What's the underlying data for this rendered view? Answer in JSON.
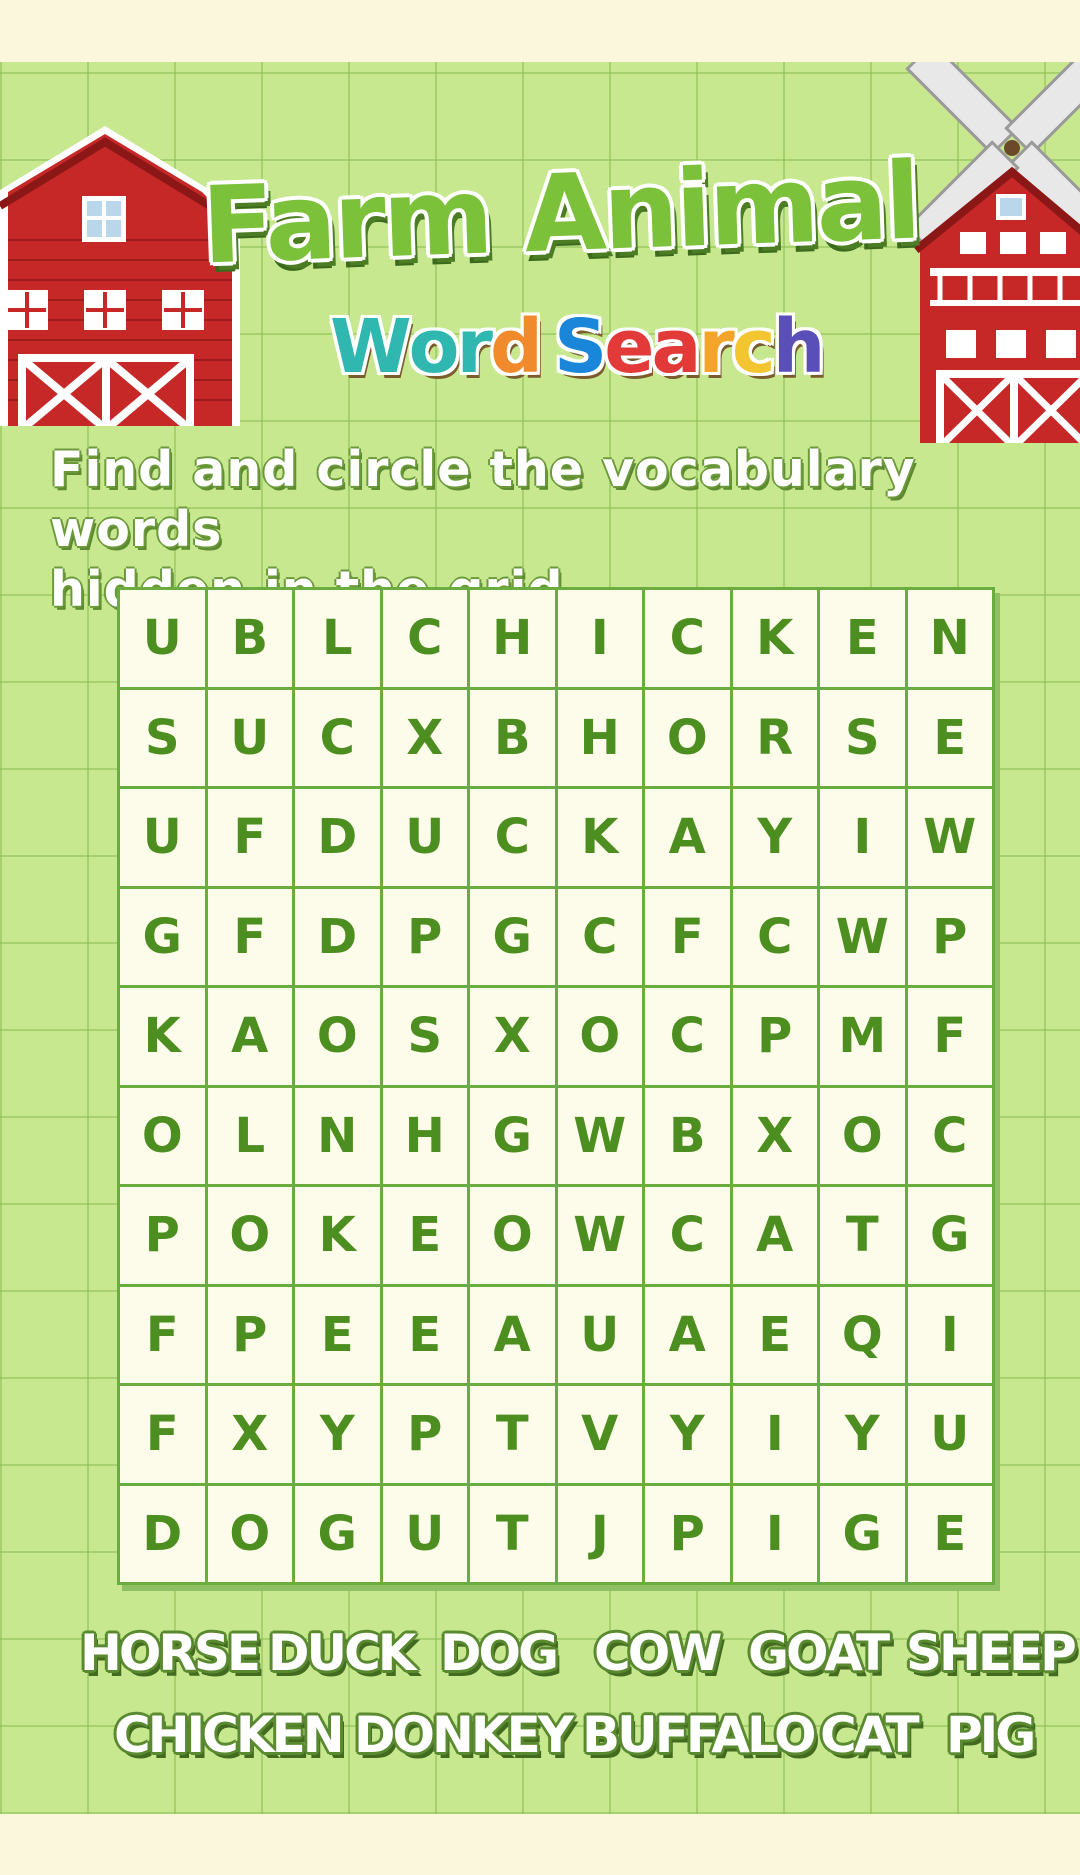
{
  "title": {
    "main": "Farm Animal",
    "sub_letters": [
      {
        "ch": "W",
        "color": "#2fb7b0"
      },
      {
        "ch": "o",
        "color": "#2fb7b0"
      },
      {
        "ch": "r",
        "color": "#2fb7b0"
      },
      {
        "ch": "d",
        "color": "#f08a2a"
      },
      {
        "ch": " ",
        "color": "#ffffff"
      },
      {
        "ch": "S",
        "color": "#1a86d9"
      },
      {
        "ch": "e",
        "color": "#e23a38"
      },
      {
        "ch": "a",
        "color": "#e23a38"
      },
      {
        "ch": "r",
        "color": "#f3a52b"
      },
      {
        "ch": "c",
        "color": "#f3c530"
      },
      {
        "ch": "h",
        "color": "#5a4fb9"
      }
    ]
  },
  "instruction": {
    "line1": "Find and circle the vocabulary words",
    "line2": "hidden in the grid."
  },
  "grid": [
    [
      "U",
      "B",
      "L",
      "C",
      "H",
      "I",
      "C",
      "K",
      "E",
      "N"
    ],
    [
      "S",
      "U",
      "C",
      "X",
      "B",
      "H",
      "O",
      "R",
      "S",
      "E"
    ],
    [
      "U",
      "F",
      "D",
      "U",
      "C",
      "K",
      "A",
      "Y",
      "I",
      "W"
    ],
    [
      "G",
      "F",
      "D",
      "P",
      "G",
      "C",
      "F",
      "C",
      "W",
      "P"
    ],
    [
      "K",
      "A",
      "O",
      "S",
      "X",
      "O",
      "C",
      "P",
      "M",
      "F"
    ],
    [
      "O",
      "L",
      "N",
      "H",
      "G",
      "W",
      "B",
      "X",
      "O",
      "C"
    ],
    [
      "P",
      "O",
      "K",
      "E",
      "O",
      "W",
      "C",
      "A",
      "T",
      "G"
    ],
    [
      "F",
      "P",
      "E",
      "E",
      "A",
      "U",
      "A",
      "E",
      "Q",
      "I"
    ],
    [
      "F",
      "X",
      "Y",
      "P",
      "T",
      "V",
      "Y",
      "I",
      "Y",
      "U"
    ],
    [
      "D",
      "O",
      "G",
      "U",
      "T",
      "J",
      "P",
      "I",
      "G",
      "E"
    ]
  ],
  "words": {
    "row1": [
      "HORSE",
      "DUCK",
      "DOG",
      "COW",
      "GOAT",
      "SHEEP"
    ],
    "row2": [
      "CHICKEN",
      "DONKEY",
      "BUFFALO",
      "CAT",
      "PIG"
    ]
  },
  "colors": {
    "board": "#c7e88f",
    "letter": "#4c8e1f",
    "barn_red": "#c62828"
  }
}
